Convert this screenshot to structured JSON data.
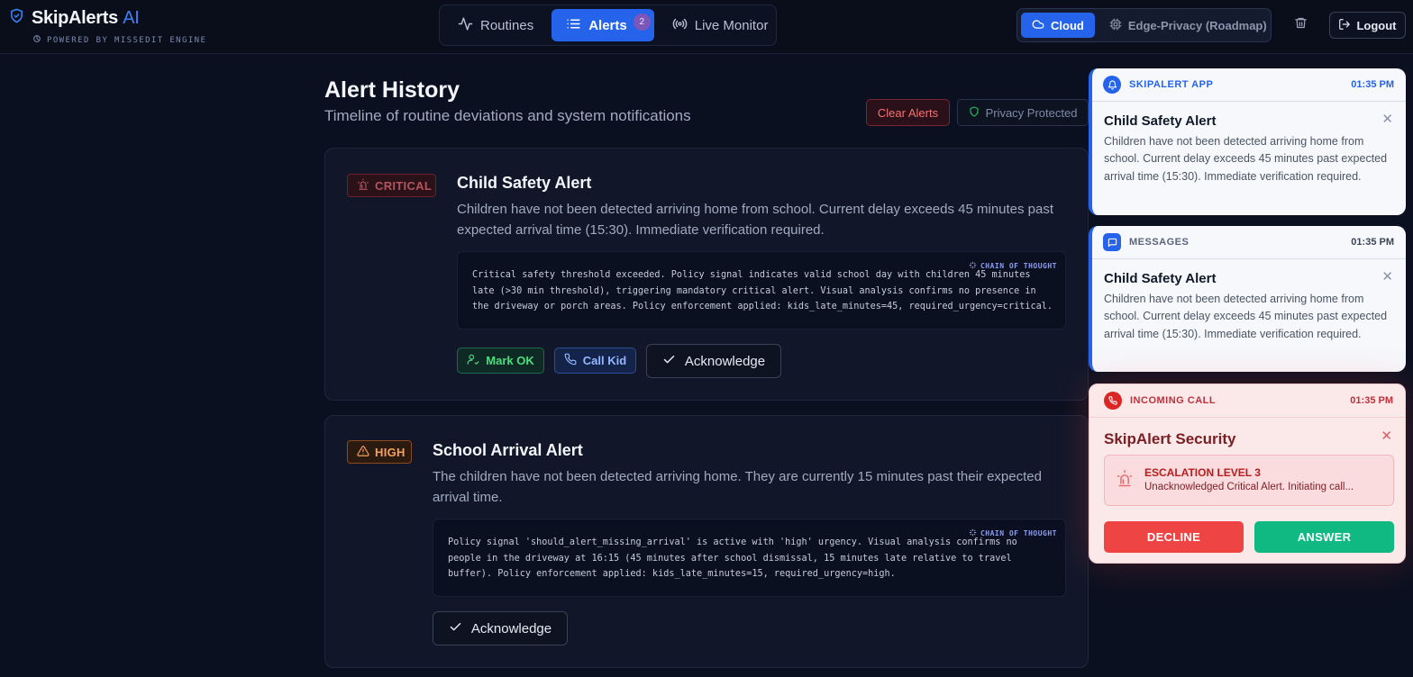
{
  "brand": {
    "name": "SkipAlerts",
    "name_suffix": "AI",
    "subtitle": "POWERED BY MISSEDIT ENGINE"
  },
  "nav": {
    "tabs": [
      {
        "label": "Routines",
        "icon": "activity-icon"
      },
      {
        "label": "Alerts",
        "icon": "list-icon",
        "badge": "2",
        "active": true
      },
      {
        "label": "Live Monitor",
        "icon": "broadcast-icon"
      }
    ]
  },
  "mode": {
    "options": [
      {
        "label": "Cloud",
        "icon": "cloud-icon",
        "active": true
      },
      {
        "label": "Edge-Privacy (Roadmap)",
        "icon": "chip-icon"
      }
    ]
  },
  "header_actions": {
    "trash_icon": "trash-icon",
    "logout_label": "Logout"
  },
  "page": {
    "title": "Alert History",
    "subtitle": "Timeline of routine deviations and system notifications",
    "clear_label": "Clear Alerts",
    "privacy_label": "Privacy Protected"
  },
  "alerts": [
    {
      "severity": "CRITICAL",
      "title": "Child Safety Alert",
      "message": "Children have not been detected arriving home from school. Current delay exceeds 45 minutes past expected arrival time (15:30). Immediate verification required.",
      "cot_label": "CHAIN OF THOUGHT",
      "cot": "Critical safety threshold exceeded. Policy signal indicates valid school day with children 45 minutes late (>30 min threshold), triggering mandatory critical alert. Visual analysis confirms no presence in the driveway or porch areas. Policy enforcement applied: kids_late_minutes=45, required_urgency=critical.",
      "actions": {
        "mark_ok": "Mark OK",
        "call_kid": "Call Kid",
        "acknowledge": "Acknowledge"
      }
    },
    {
      "severity": "HIGH",
      "title": "School Arrival Alert",
      "message": "The children have not been detected arriving home. They are currently 15 minutes past their expected arrival time.",
      "cot_label": "CHAIN OF THOUGHT",
      "cot": "Policy signal 'should_alert_missing_arrival' is active with 'high' urgency. Visual analysis confirms no people in the driveway at 16:15 (45 minutes after school dismissal, 15 minutes late relative to travel buffer). Policy enforcement applied: kids_late_minutes=15, required_urgency=high.",
      "actions": {
        "acknowledge": "Acknowledge"
      }
    }
  ],
  "notifications": [
    {
      "app": "SKIPALERT APP",
      "time": "01:35 PM",
      "icon": "bell-icon",
      "title": "Child Safety Alert",
      "body": "Children have not been detected arriving home from school. Current delay exceeds 45 minutes past expected arrival time (15:30). Immediate verification required."
    },
    {
      "app": "MESSAGES",
      "time": "01:35 PM",
      "icon": "message-icon",
      "title": "Child Safety Alert",
      "body": "Children have not been detected arriving home from school. Current delay exceeds 45 minutes past expected arrival time (15:30). Immediate verification required."
    }
  ],
  "call": {
    "app": "INCOMING CALL",
    "time": "01:35 PM",
    "caller": "SkipAlert Security",
    "escalation_title": "ESCALATION LEVEL 3",
    "escalation_text": "Unacknowledged Critical Alert. Initiating call...",
    "decline_label": "DECLINE",
    "answer_label": "ANSWER"
  },
  "colors": {
    "accent": "#2563eb",
    "critical": "#ef4444",
    "high": "#f7a15a",
    "success": "#10b981"
  }
}
